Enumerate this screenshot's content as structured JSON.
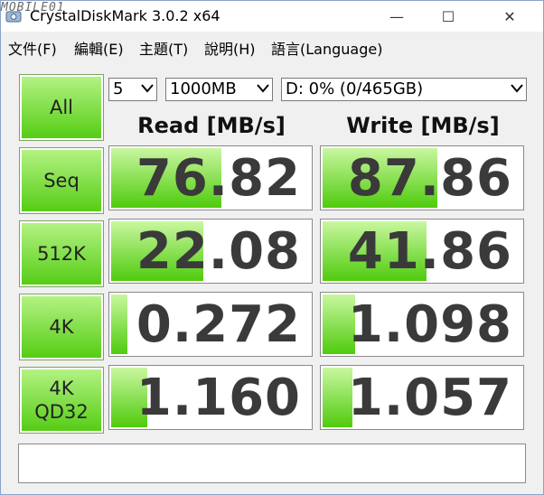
{
  "window": {
    "title": "CrystalDiskMark 3.0.2 x64",
    "watermark": "MOBILE01"
  },
  "window_controls": {
    "minimize": "—",
    "maximize": "☐",
    "close": "✕"
  },
  "menu": [
    "文件(F)",
    "編輯(E)",
    "主題(T)",
    "說明(H)",
    "語言(Language)"
  ],
  "controls": {
    "all_label": "All",
    "count_value": "5",
    "size_value": "1000MB",
    "drive_value": "D: 0% (0/465GB)"
  },
  "headers": {
    "read": "Read [MB/s]",
    "write": "Write [MB/s]"
  },
  "rows": [
    {
      "label": "Seq",
      "label2": "",
      "read": "76.82",
      "write": "87.86",
      "read_level": 0.55,
      "write_level": 0.57
    },
    {
      "label": "512K",
      "label2": "",
      "read": "22.08",
      "write": "41.86",
      "read_level": 0.46,
      "write_level": 0.52
    },
    {
      "label": "4K",
      "label2": "",
      "read": "0.272",
      "write": "1.098",
      "read_level": 0.08,
      "write_level": 0.16
    },
    {
      "label": "4K",
      "label2": "QD32",
      "read": "1.160",
      "write": "1.057",
      "read_level": 0.18,
      "write_level": 0.15
    }
  ],
  "status": "",
  "colors": {
    "accent": "#53cc12",
    "accent_light": "#c9f7a0"
  }
}
